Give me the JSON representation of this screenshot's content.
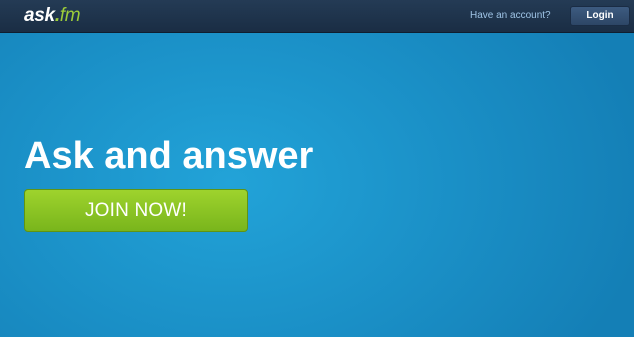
{
  "header": {
    "logo": {
      "ask": "ask",
      "dot": ".",
      "fm": "fm"
    },
    "have_account_text": "Have an account?",
    "login_label": "Login"
  },
  "hero": {
    "headline": "Ask and answer",
    "join_label": "JOIN NOW!"
  },
  "colors": {
    "topbar": "#1f334c",
    "hero_background": "#1a8fc6",
    "accent_green": "#8cc63f",
    "logo_green": "#9ccc3a"
  }
}
